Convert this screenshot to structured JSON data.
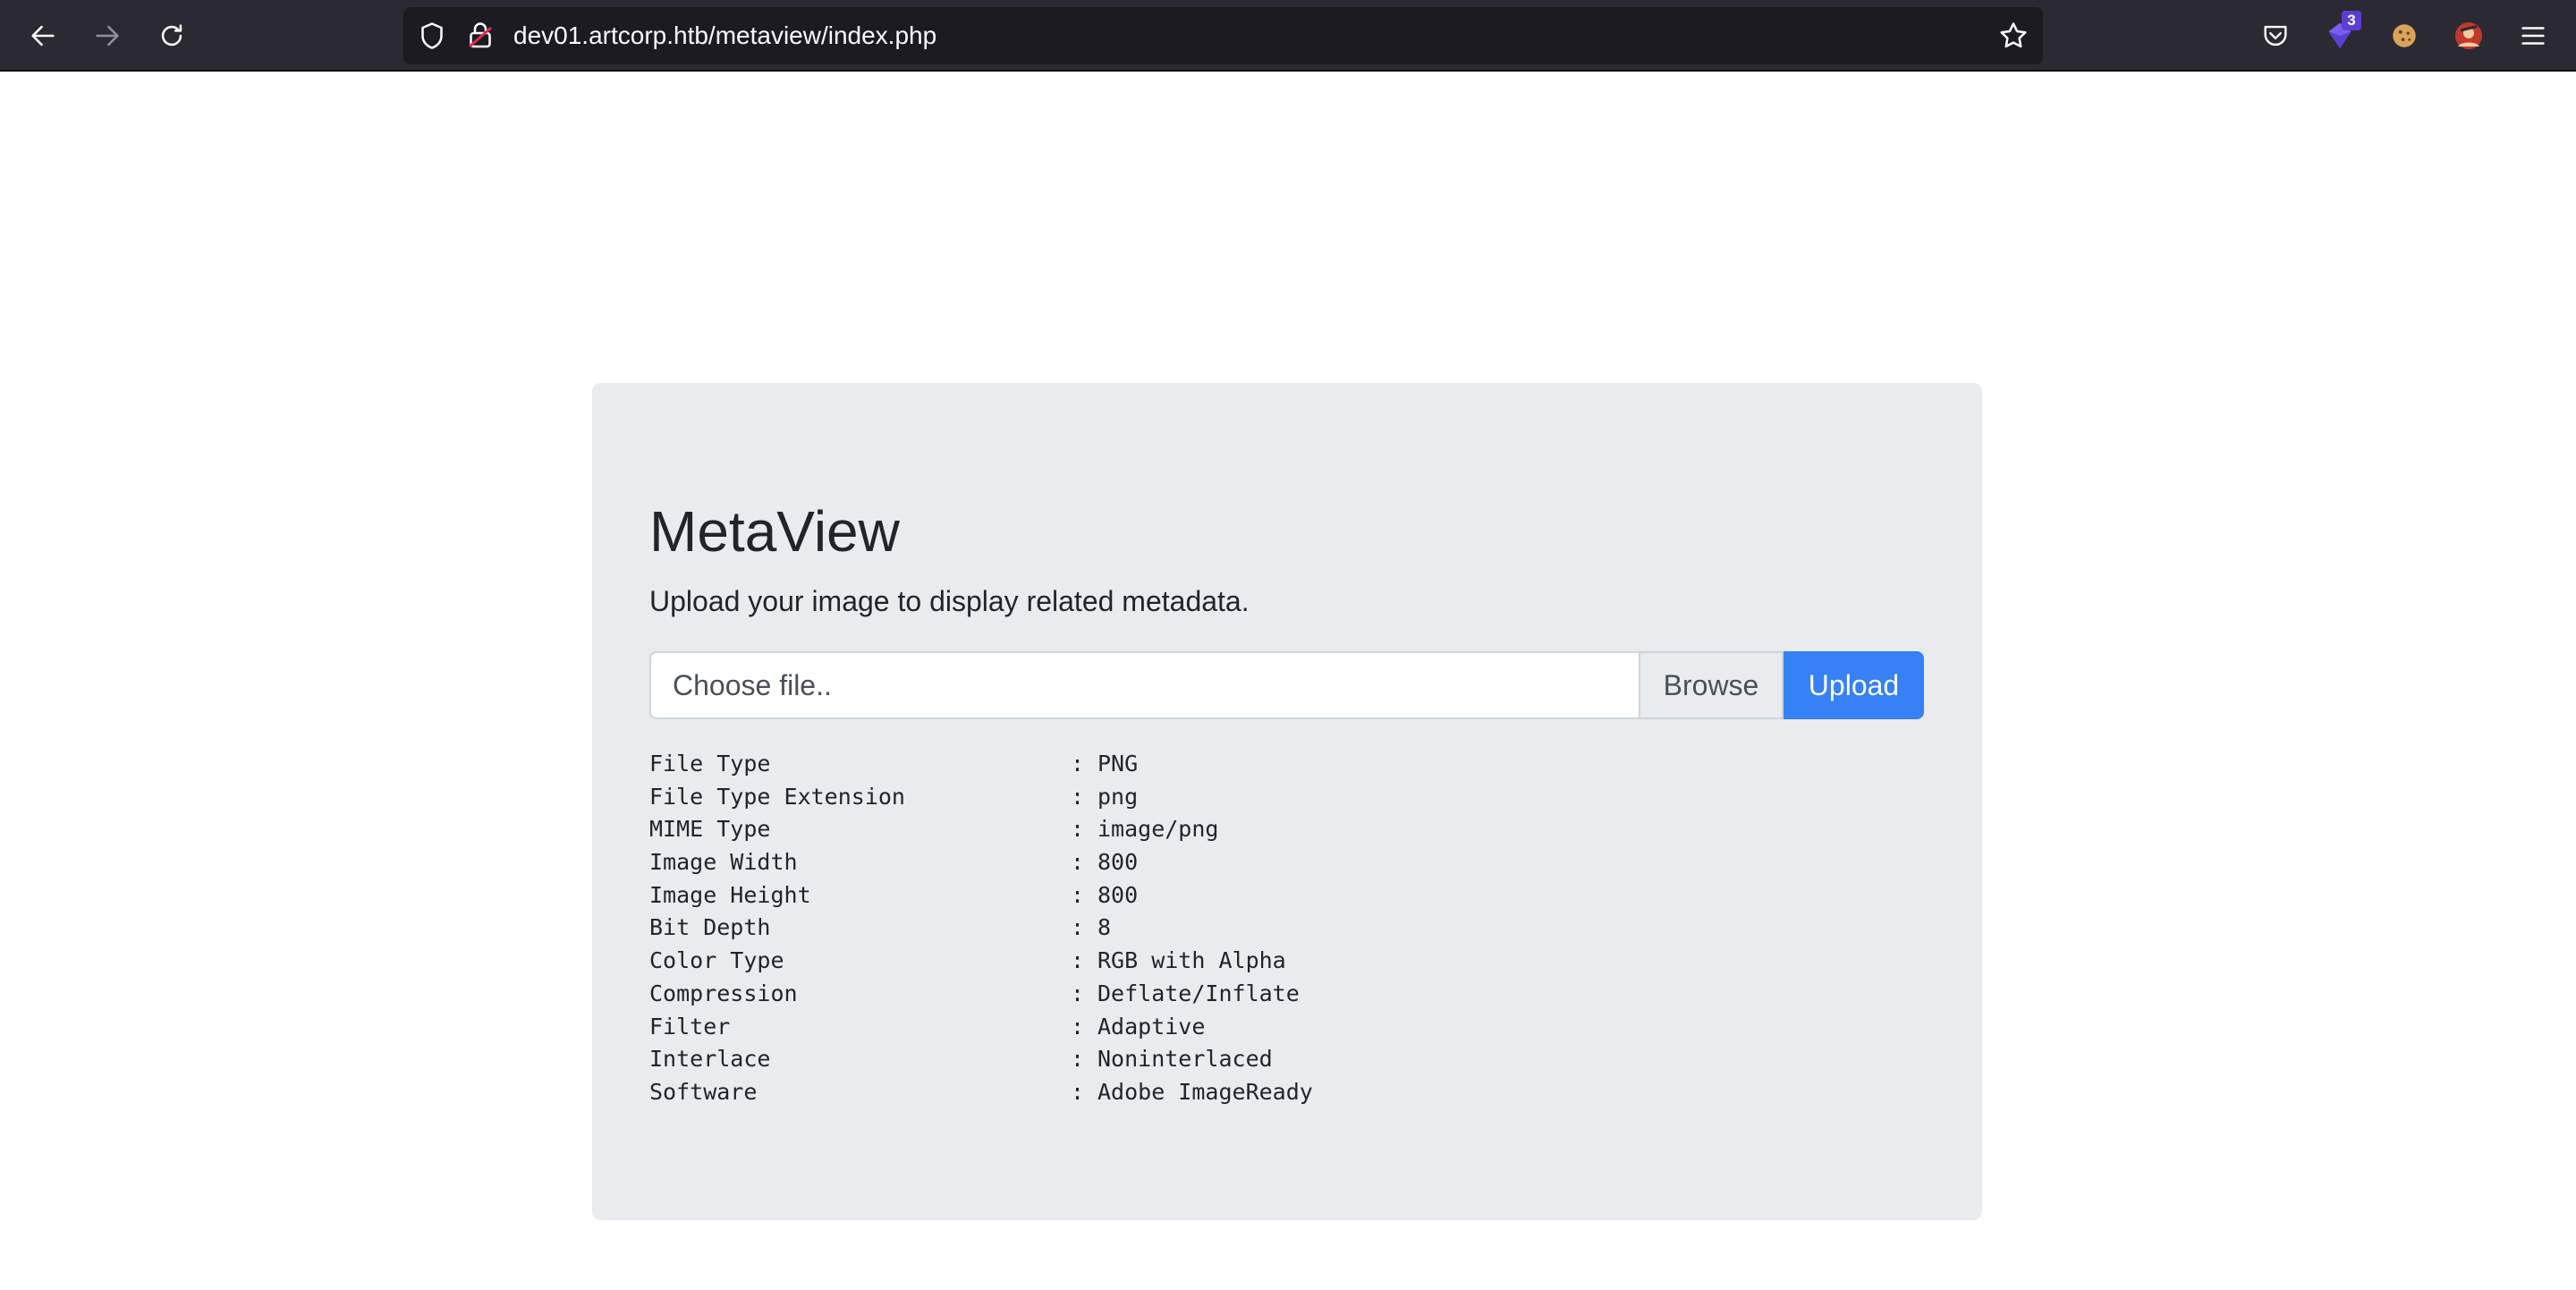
{
  "browser": {
    "url": "dev01.artcorp.htb/metaview/index.php",
    "extension_badge": "3",
    "icons": [
      "back-icon",
      "forward-icon",
      "reload-icon",
      "shield-icon",
      "lock-icon",
      "star-icon",
      "pocket-icon",
      "extension-icon",
      "cookie-icon",
      "avatar-icon",
      "menu-icon"
    ]
  },
  "page": {
    "title": "MetaView",
    "lead": "Upload your image to display related metadata.",
    "file_input_placeholder": "Choose file..",
    "browse_label": "Browse",
    "upload_label": "Upload",
    "metadata": [
      {
        "key": "File Type",
        "value": "PNG"
      },
      {
        "key": "File Type Extension",
        "value": "png"
      },
      {
        "key": "MIME Type",
        "value": "image/png"
      },
      {
        "key": "Image Width",
        "value": "800"
      },
      {
        "key": "Image Height",
        "value": "800"
      },
      {
        "key": "Bit Depth",
        "value": "8"
      },
      {
        "key": "Color Type",
        "value": "RGB with Alpha"
      },
      {
        "key": "Compression",
        "value": "Deflate/Inflate"
      },
      {
        "key": "Filter",
        "value": "Adaptive"
      },
      {
        "key": "Interlace",
        "value": "Noninterlaced"
      },
      {
        "key": "Software",
        "value": "Adobe ImageReady"
      }
    ],
    "separator": ":"
  },
  "colors": {
    "toolbar_bg": "#2b2a33",
    "urlbar_bg": "#1c1b22",
    "card_bg": "#e9ebef",
    "upload_button": "#3581f5"
  }
}
